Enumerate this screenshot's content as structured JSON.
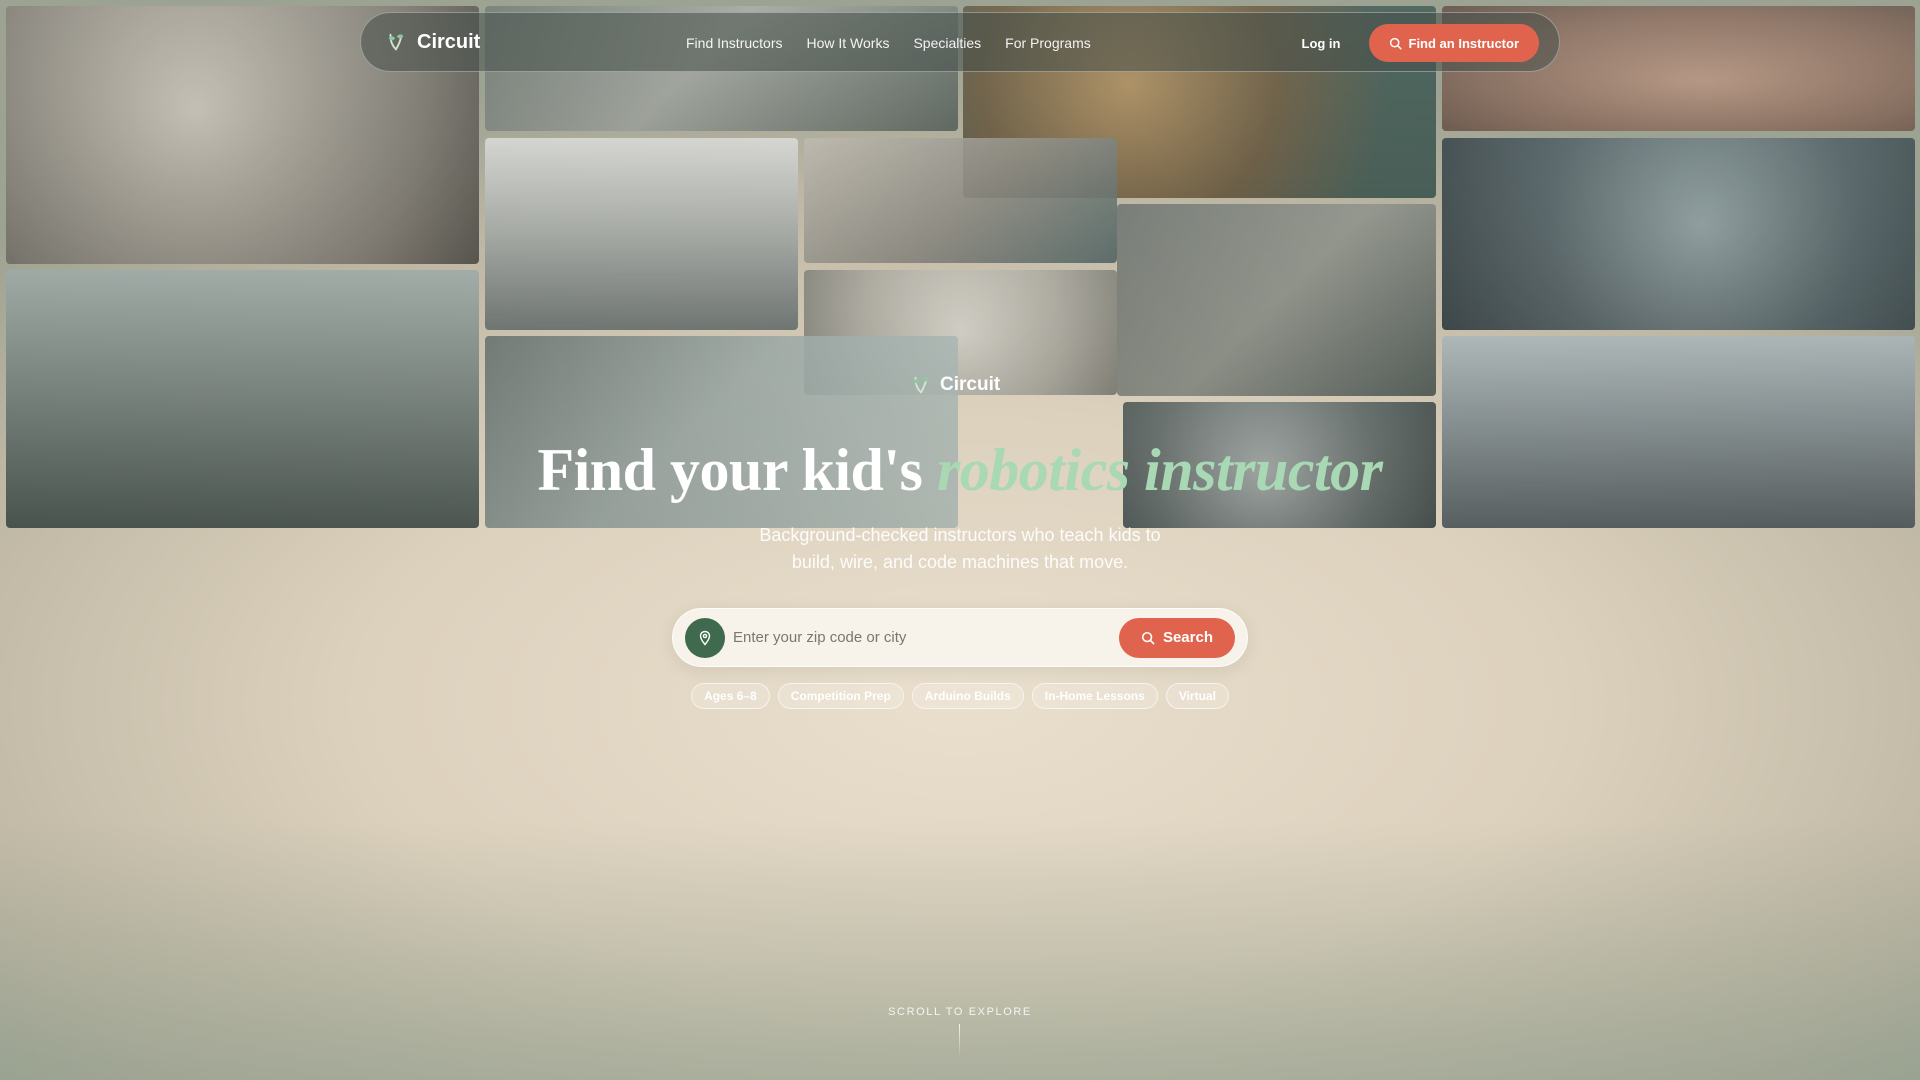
{
  "brand": {
    "name": "Circuit",
    "icon": "circuit-leaf-logo-icon"
  },
  "nav": {
    "links": [
      "Find Instructors",
      "How It Works",
      "Specialties",
      "For Programs"
    ],
    "login": "Log in",
    "cta": "Find an Instructor",
    "cta_icon": "search-icon"
  },
  "hero": {
    "brand_name": "Circuit",
    "headline_start": "Find your kid's",
    "headline_accent": "robotics instructor",
    "subhead": "Background-checked instructors who teach kids to build, wire, and code machines that move."
  },
  "search": {
    "placeholder": "Enter your zip code or city",
    "value": "",
    "button": "Search",
    "pin_icon": "location-pin-icon"
  },
  "chips": [
    "Ages 6–8",
    "Competition Prep",
    "Arduino Builds",
    "In-Home Lessons",
    "Virtual"
  ],
  "scroll_label": "SCROLL TO EXPLORE",
  "colors": {
    "accent": "#e0644d",
    "green": "#3f6a4e",
    "headline_accent": "#a8d8b4"
  },
  "collage": [
    "hands-wiring-photo",
    "tools-workbench-photo",
    "gears-parts-photo",
    "child-eyes-photo",
    "kids-cheering-robot-photo",
    "coding-camp-classroom-photo",
    "soldering-circuit-photo",
    "robot-rover-arena-photo",
    "breadboard-laptop-photo",
    "motor-parts-photo",
    "child-tablet-coding-photo",
    "wheel-motor-photo",
    "robotics-lab-photo"
  ]
}
